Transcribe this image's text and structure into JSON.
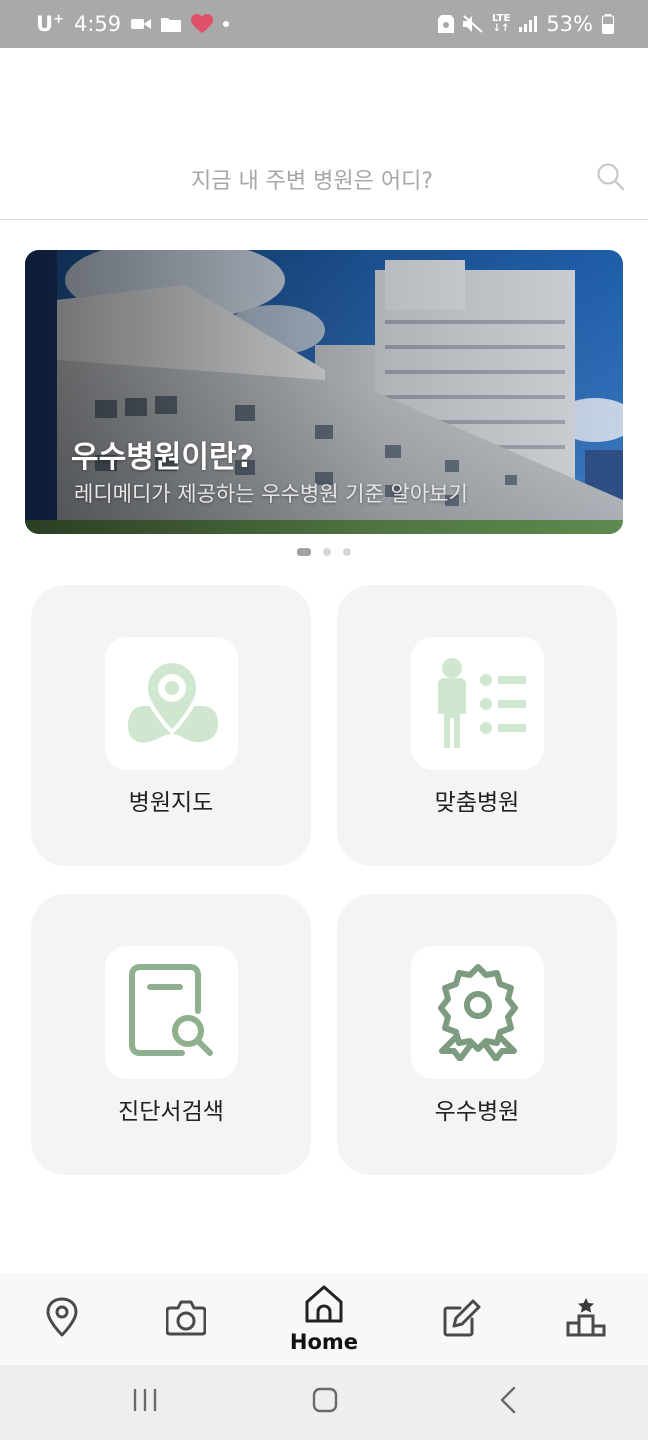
{
  "status_bar": {
    "carrier": "U",
    "carrier_sup": "+",
    "time": "4:59",
    "network": "LTE",
    "battery": "53%"
  },
  "search": {
    "placeholder": "지금 내 주변 병원은 어디?",
    "icon": "search-icon"
  },
  "banner": {
    "title": "우수병원이란?",
    "subtitle": "레디메디가 제공하는 우수병원 기준 알아보기",
    "slide_count": 3,
    "active_slide": 1
  },
  "menu": [
    {
      "label": "병원지도",
      "icon": "map-pin-icon"
    },
    {
      "label": "맞춤병원",
      "icon": "person-list-icon"
    },
    {
      "label": "진단서검색",
      "icon": "document-search-icon"
    },
    {
      "label": "우수병원",
      "icon": "award-badge-icon"
    }
  ],
  "bottom_nav": {
    "items": [
      {
        "icon": "location-icon"
      },
      {
        "icon": "camera-icon"
      },
      {
        "icon": "home-icon",
        "label": "Home",
        "active": true
      },
      {
        "icon": "edit-icon"
      },
      {
        "icon": "ranking-icon"
      }
    ]
  },
  "colors": {
    "icon_light_green": "#cfe6cf",
    "icon_dark_green": "#7d9b7f",
    "card_bg": "#f4f4f4",
    "status_bar_bg": "#a9a9a9"
  }
}
